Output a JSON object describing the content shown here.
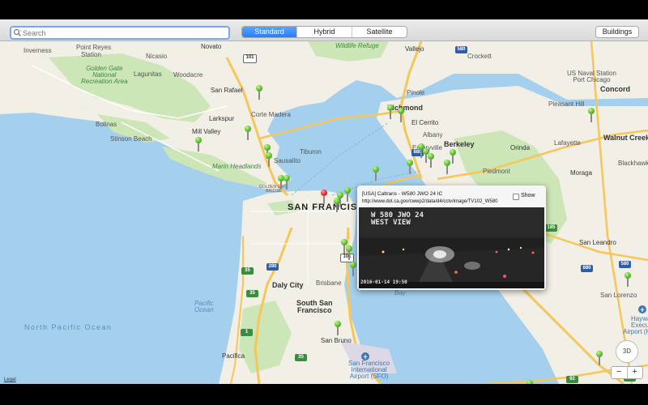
{
  "toolbar": {
    "search_placeholder": "Search",
    "map_types": [
      "Standard",
      "Hybrid",
      "Satellite"
    ],
    "selected_map_type": "Standard",
    "buildings_label": "Buildings"
  },
  "map": {
    "labels": {
      "inverness": "Inverness",
      "point_reyes": "Point Reyes",
      "station": "Station",
      "nicasio": "Nicasio",
      "novato": "Novato",
      "ggnra": "Golden Gate\nNational\nRecreation Area",
      "lagunitas": "Lagunitas",
      "woodacre": "Woodacre",
      "san_rafael": "San Rafael",
      "larkspur": "Larkspur",
      "corte_madera": "Corte Madera",
      "bolinas": "Bolinas",
      "stinson_beach": "Stinson Beach",
      "mill_valley": "Mill Valley",
      "tiburon": "Tiburon",
      "sausalito": "Sausalito",
      "marin_headlands": "Marin Headlands",
      "golden_gate_bridge": "GOLDEN GATE\nBRIDGE",
      "san_francisco": "SAN FRANCISCO",
      "daly_city": "Daly City",
      "brisbane": "Brisbane",
      "south_san_francisco": "South San\nFrancisco",
      "pacifica_water": "Pacific\nOcean",
      "north_pacific_ocean": "North Pacific Ocean",
      "san_bruno": "San Bruno",
      "pacifica": "Pacifica",
      "sfo": "San Francisco\nInternational\nAirport (SFO)",
      "wildlife_refuge": "Wildlife Refuge",
      "vallejo": "Vallejo",
      "crockett": "Crockett",
      "us_naval_station": "US Naval Station\nPort Chicago",
      "concord": "Concord",
      "pinole": "Pinole",
      "richmond": "Richmond",
      "el_cerrito": "El Cerrito",
      "pleasant_hill": "Pleasant Hill",
      "albany": "Albany",
      "berkeley": "Berkeley",
      "orinda": "Orinda",
      "lafayette": "Lafayette",
      "walnut_creek": "Walnut Creek",
      "emeryville": "Emeryville",
      "moraga": "Moraga",
      "blackhawk": "Blackhawk",
      "piedmont": "Piedmont",
      "san_leandro": "San Leandro",
      "san_lorenzo": "San Lorenzo",
      "hayward": "Haywa",
      "hayward_exec": "Execu",
      "hayward_airport": "Airport (H",
      "bay": "Bay"
    },
    "highways": [
      "101",
      "101",
      "580",
      "880",
      "185",
      "280",
      "35",
      "35",
      "1",
      "35",
      "580",
      "880",
      "92",
      "92"
    ]
  },
  "camera_popup": {
    "title": "[USA] Caltrans - W580 JWO 24 IC",
    "url": "http://www.dot.ca.gov/cwwp2/data/d4/cctv/image/TV102_W580",
    "show_label": "Show",
    "show_checked": false,
    "overlay_line1": "W 580 JWO 24",
    "overlay_line2": "WEST VIEW",
    "timestamp": "2016-01-14 19:50"
  },
  "controls": {
    "legal_label": "Legal",
    "compass_label": "3D",
    "zoom_out": "−",
    "zoom_in": "+"
  },
  "colors": {
    "water": "#a4d0ee",
    "land": "#f2efe6",
    "park": "#cde6b8",
    "freeway": "#f6c659",
    "pin_green": "#4cbb22",
    "pin_red": "#e02020",
    "selected_tab": "#2a7ef4"
  }
}
